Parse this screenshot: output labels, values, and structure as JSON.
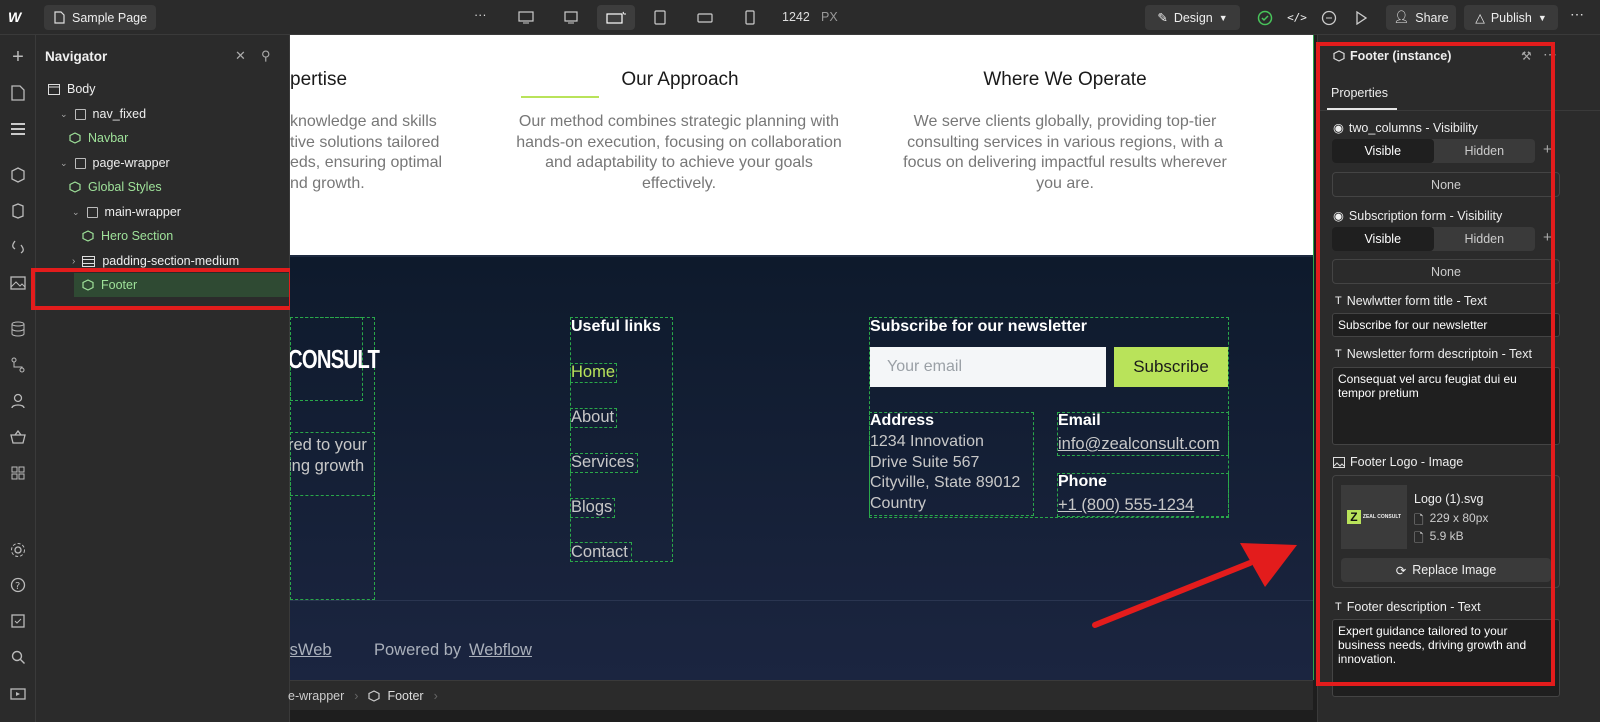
{
  "topbar": {
    "page_name": "Sample Page",
    "more": "···",
    "width_value": "1242",
    "width_unit": "PX",
    "design_label": "Design",
    "share_label": "Share",
    "publish_label": "Publish"
  },
  "navigator": {
    "title": "Navigator",
    "items": [
      {
        "label": "Body"
      },
      {
        "label": "nav_fixed"
      },
      {
        "label": "Navbar"
      },
      {
        "label": "page-wrapper"
      },
      {
        "label": "Global Styles"
      },
      {
        "label": "main-wrapper"
      },
      {
        "label": "Hero Section"
      },
      {
        "label": "padding-section-medium"
      },
      {
        "label": "Footer"
      }
    ]
  },
  "canvas": {
    "col1_title": "pertise",
    "col1_desc": [
      "knowledge and skills",
      "tive solutions tailored",
      "eds, ensuring optimal",
      "nd growth."
    ],
    "col2_title": "Our Approach",
    "col2_desc": "Our method combines strategic planning with hands-on execution, focusing on collaboration and adaptability to achieve your goals effectively.",
    "col3_title": "Where We Operate",
    "col3_desc": "We serve clients globally, providing top-tier consulting services in various regions, with a focus on delivering impactful results wherever you are.",
    "footer": {
      "logo_text": "CONSULT",
      "desc_lines": [
        "red to your",
        "ing growth"
      ],
      "useful_links_title": "Useful links",
      "links": [
        "Home",
        "About",
        "Services",
        "Blogs",
        "Contact"
      ],
      "newsletter_title": "Subscribe for our newsletter",
      "email_placeholder": "Your email",
      "subscribe_label": "Subscribe",
      "address_title": "Address",
      "address_lines": [
        "1234 Innovation",
        "Drive Suite 567",
        "Cityville, State 89012",
        "Country"
      ],
      "email_title": "Email",
      "email_value": "info@zealconsult.com",
      "phone_title": "Phone",
      "phone_value": "+1 (800) 555-1234",
      "credit_left": "isWeb",
      "powered_by": "Powered by",
      "powered_link": "Webflow"
    }
  },
  "breadcrumbs": [
    "e-wrapper",
    "Footer"
  ],
  "right_panel": {
    "title": "Footer (instance)",
    "tab": "Properties",
    "two_columns_label": "two_columns - Visibility",
    "subscription_label": "Subscription form - Visibility",
    "visible": "Visible",
    "hidden": "Hidden",
    "none": "None",
    "newsletter_title_label": "Newlwtter form title - Text",
    "newsletter_title_value": "Subscribe for our newsletter",
    "newsletter_desc_label": "Newsletter form descriptoin - Text",
    "newsletter_desc_value": "Consequat vel arcu feugiat dui eu tempor pretium",
    "footer_logo_label": "Footer Logo - Image",
    "image_name": "Logo (1).svg",
    "image_dims": "229 x 80px",
    "image_size": "5.9 kB",
    "thumb_text": "ZEAL CONSULT",
    "replace_label": "Replace Image",
    "footer_desc_label": "Footer description - Text",
    "footer_desc_value": "Expert guidance tailored to your business needs, driving growth and innovation."
  },
  "colors": {
    "annotation_red": "#e31c1c",
    "accent_green": "#b9e35a",
    "component_green": "#9fe29a",
    "footer_bg": "#0e1a2c"
  }
}
